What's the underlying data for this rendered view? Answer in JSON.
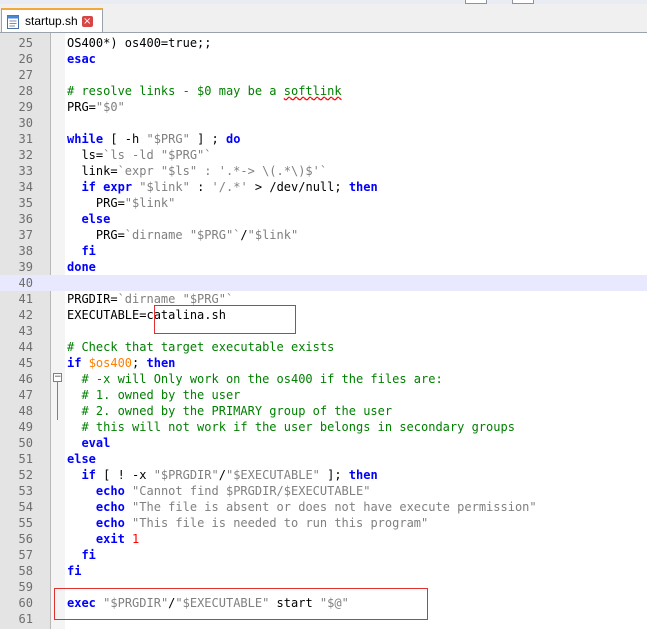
{
  "tab": {
    "label": "startup.sh",
    "close_glyph": "×"
  },
  "colors": {
    "keyword": "#0000ff",
    "string": "#808080",
    "comment": "#008000",
    "variable": "#ff8000",
    "number": "#ff0000",
    "annotation_box": "#e03030"
  },
  "current_line": 40,
  "editor": {
    "lines": [
      {
        "num": "25",
        "tokens": [
          {
            "t": "OS400*) os400=true;;",
            "c": ""
          }
        ]
      },
      {
        "num": "26",
        "tokens": [
          {
            "t": "esac",
            "c": "k"
          }
        ]
      },
      {
        "num": "27",
        "tokens": []
      },
      {
        "num": "28",
        "tokens": [
          {
            "t": "# resolve links - $0 may be a ",
            "c": "c"
          },
          {
            "t": "softlink",
            "c": "c spell"
          }
        ]
      },
      {
        "num": "29",
        "tokens": [
          {
            "t": "PRG=",
            "c": ""
          },
          {
            "t": "\"$0\"",
            "c": "s"
          }
        ]
      },
      {
        "num": "30",
        "tokens": []
      },
      {
        "num": "31",
        "tokens": [
          {
            "t": "while",
            "c": "k"
          },
          {
            "t": " [ -h ",
            "c": ""
          },
          {
            "t": "\"$PRG\"",
            "c": "s"
          },
          {
            "t": " ] ; ",
            "c": ""
          },
          {
            "t": "do",
            "c": "k"
          }
        ]
      },
      {
        "num": "32",
        "tokens": [
          {
            "t": "  ls=",
            "c": ""
          },
          {
            "t": "`ls -ld \"$PRG\"`",
            "c": "s"
          }
        ]
      },
      {
        "num": "33",
        "tokens": [
          {
            "t": "  link=",
            "c": ""
          },
          {
            "t": "`expr \"$ls\" : '.*-> \\(.*\\)$'`",
            "c": "s"
          }
        ]
      },
      {
        "num": "34",
        "tokens": [
          {
            "t": "  ",
            "c": ""
          },
          {
            "t": "if",
            "c": "k"
          },
          {
            "t": " ",
            "c": ""
          },
          {
            "t": "expr",
            "c": "k"
          },
          {
            "t": " ",
            "c": ""
          },
          {
            "t": "\"$link\"",
            "c": "s"
          },
          {
            "t": " : ",
            "c": ""
          },
          {
            "t": "'/.*'",
            "c": "s"
          },
          {
            "t": " > /dev/null; ",
            "c": ""
          },
          {
            "t": "then",
            "c": "k"
          }
        ]
      },
      {
        "num": "35",
        "tokens": [
          {
            "t": "    PRG=",
            "c": ""
          },
          {
            "t": "\"$link\"",
            "c": "s"
          }
        ]
      },
      {
        "num": "36",
        "tokens": [
          {
            "t": "  ",
            "c": ""
          },
          {
            "t": "else",
            "c": "k"
          }
        ]
      },
      {
        "num": "37",
        "tokens": [
          {
            "t": "    PRG=",
            "c": ""
          },
          {
            "t": "`dirname \"$PRG\"`",
            "c": "s"
          },
          {
            "t": "/",
            "c": ""
          },
          {
            "t": "\"$link\"",
            "c": "s"
          }
        ]
      },
      {
        "num": "38",
        "tokens": [
          {
            "t": "  ",
            "c": ""
          },
          {
            "t": "fi",
            "c": "k"
          }
        ]
      },
      {
        "num": "39",
        "tokens": [
          {
            "t": "done",
            "c": "k"
          }
        ]
      },
      {
        "num": "40",
        "tokens": []
      },
      {
        "num": "41",
        "tokens": [
          {
            "t": "PRGDIR=",
            "c": ""
          },
          {
            "t": "`dirname \"$PRG\"`",
            "c": "s"
          }
        ]
      },
      {
        "num": "42",
        "tokens": [
          {
            "t": "EXECUTABLE=catalina.sh",
            "c": ""
          }
        ]
      },
      {
        "num": "43",
        "tokens": []
      },
      {
        "num": "44",
        "tokens": [
          {
            "t": "# Check that target executable exists",
            "c": "c"
          }
        ]
      },
      {
        "num": "45",
        "tokens": [
          {
            "t": "if",
            "c": "k"
          },
          {
            "t": " ",
            "c": ""
          },
          {
            "t": "$os400",
            "c": "v"
          },
          {
            "t": "; ",
            "c": ""
          },
          {
            "t": "then",
            "c": "k"
          }
        ]
      },
      {
        "num": "46",
        "tokens": [
          {
            "t": "  # -x will Only work on the os400 if the files are:",
            "c": "c"
          }
        ]
      },
      {
        "num": "47",
        "tokens": [
          {
            "t": "  # 1. owned by the user",
            "c": "c"
          }
        ]
      },
      {
        "num": "48",
        "tokens": [
          {
            "t": "  # 2. owned by the PRIMARY group of the user",
            "c": "c"
          }
        ]
      },
      {
        "num": "49",
        "tokens": [
          {
            "t": "  # this will not work if the user belongs in secondary groups",
            "c": "c"
          }
        ]
      },
      {
        "num": "50",
        "tokens": [
          {
            "t": "  ",
            "c": ""
          },
          {
            "t": "eval",
            "c": "k"
          }
        ]
      },
      {
        "num": "51",
        "tokens": [
          {
            "t": "else",
            "c": "k"
          }
        ]
      },
      {
        "num": "52",
        "tokens": [
          {
            "t": "  ",
            "c": ""
          },
          {
            "t": "if",
            "c": "k"
          },
          {
            "t": " [ ! -x ",
            "c": ""
          },
          {
            "t": "\"$PRGDIR\"",
            "c": "s"
          },
          {
            "t": "/",
            "c": ""
          },
          {
            "t": "\"$EXECUTABLE\"",
            "c": "s"
          },
          {
            "t": " ]; ",
            "c": ""
          },
          {
            "t": "then",
            "c": "k"
          }
        ]
      },
      {
        "num": "53",
        "tokens": [
          {
            "t": "    ",
            "c": ""
          },
          {
            "t": "echo",
            "c": "k"
          },
          {
            "t": " ",
            "c": ""
          },
          {
            "t": "\"Cannot find $PRGDIR/$EXECUTABLE\"",
            "c": "s"
          }
        ]
      },
      {
        "num": "54",
        "tokens": [
          {
            "t": "    ",
            "c": ""
          },
          {
            "t": "echo",
            "c": "k"
          },
          {
            "t": " ",
            "c": ""
          },
          {
            "t": "\"The file is absent or does not have execute permission\"",
            "c": "s"
          }
        ]
      },
      {
        "num": "55",
        "tokens": [
          {
            "t": "    ",
            "c": ""
          },
          {
            "t": "echo",
            "c": "k"
          },
          {
            "t": " ",
            "c": ""
          },
          {
            "t": "\"This file is needed to run this program\"",
            "c": "s"
          }
        ]
      },
      {
        "num": "56",
        "tokens": [
          {
            "t": "    ",
            "c": ""
          },
          {
            "t": "exit",
            "c": "k"
          },
          {
            "t": " ",
            "c": ""
          },
          {
            "t": "1",
            "c": "n"
          }
        ]
      },
      {
        "num": "57",
        "tokens": [
          {
            "t": "  ",
            "c": ""
          },
          {
            "t": "fi",
            "c": "k"
          }
        ]
      },
      {
        "num": "58",
        "tokens": [
          {
            "t": "fi",
            "c": "k"
          }
        ]
      },
      {
        "num": "59",
        "tokens": []
      },
      {
        "num": "60",
        "tokens": [
          {
            "t": "exec",
            "c": "k"
          },
          {
            "t": " ",
            "c": ""
          },
          {
            "t": "\"$PRGDIR\"",
            "c": "s"
          },
          {
            "t": "/",
            "c": ""
          },
          {
            "t": "\"$EXECUTABLE\"",
            "c": "s"
          },
          {
            "t": " start ",
            "c": ""
          },
          {
            "t": "\"$@\"",
            "c": "s"
          }
        ]
      },
      {
        "num": "61",
        "tokens": []
      }
    ]
  }
}
